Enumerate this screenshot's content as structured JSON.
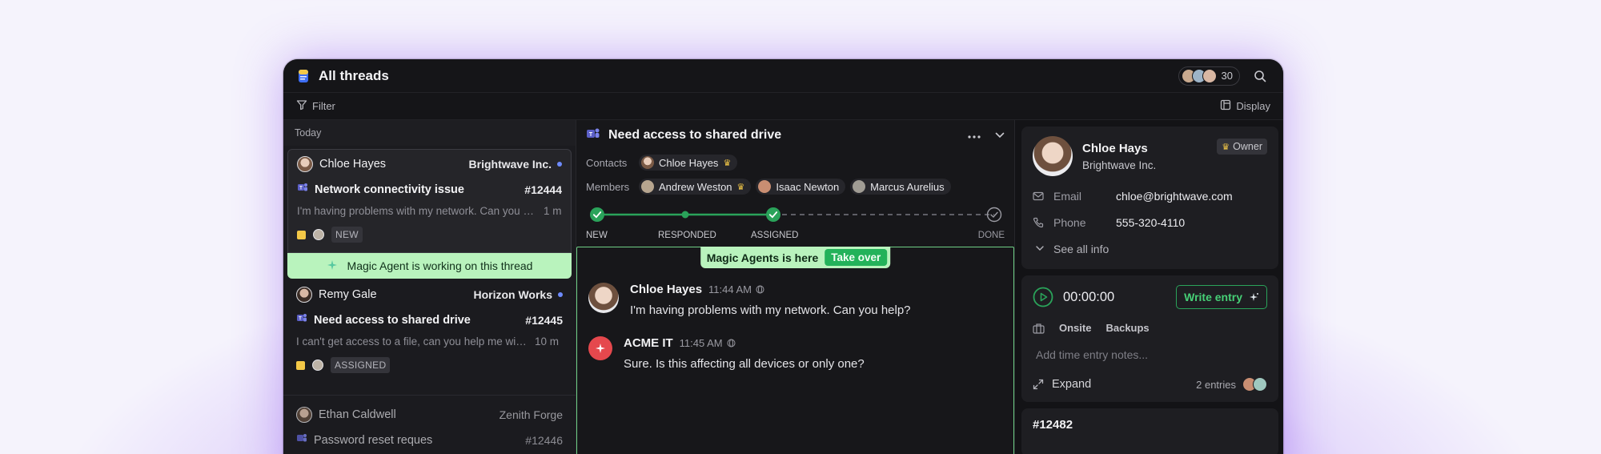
{
  "header": {
    "title": "All threads",
    "avatar_count": "30"
  },
  "filterbar": {
    "filter_label": "Filter",
    "display_label": "Display"
  },
  "list": {
    "group_label": "Today",
    "threads": [
      {
        "name": "Chloe Hayes",
        "company": "Brightwave Inc.",
        "subject": "Network connectivity issue",
        "ticket": "#12444",
        "preview": "I'm having problems with my network. Can you help?",
        "time": "1 m",
        "status": "NEW"
      },
      {
        "name": "Remy Gale",
        "company": "Horizon Works",
        "subject": "Need access to shared drive",
        "ticket": "#12445",
        "preview": "I can't get access to a file, can you help me with this?",
        "time": "10 m",
        "status": "ASSIGNED"
      },
      {
        "name": "Ethan Caldwell",
        "company": "Zenith Forge",
        "subject": "Password reset reques",
        "ticket": "#12446"
      }
    ],
    "agent_banner": "Magic Agent is working on this thread"
  },
  "thread": {
    "title": "Need access to shared drive",
    "contacts_label": "Contacts",
    "contacts": [
      "Chloe Hayes"
    ],
    "members_label": "Members",
    "members": [
      "Andrew Weston",
      "Isaac Newton",
      "Marcus Aurelius"
    ],
    "steps": [
      "NEW",
      "RESPONDED",
      "ASSIGNED",
      "DONE"
    ],
    "progress_completed_steps": 3,
    "magic_banner": "Magic Agents is here",
    "take_over_label": "Take over",
    "messages": [
      {
        "author": "Chloe Hayes",
        "time": "11:44 AM",
        "text": "I'm having problems with my network. Can you help?"
      },
      {
        "author": "ACME IT",
        "time": "11:45 AM",
        "text": "Sure. Is this affecting all devices or only one?"
      }
    ]
  },
  "contact_panel": {
    "name": "Chloe Hays",
    "company": "Brightwave Inc.",
    "role": "Owner",
    "email_label": "Email",
    "email": "chloe@brightwave.com",
    "phone_label": "Phone",
    "phone": "555-320-4110",
    "see_all": "See all info"
  },
  "time_panel": {
    "timer": "00:00:00",
    "write_entry_label": "Write entry",
    "tags": [
      "Onsite",
      "Backups"
    ],
    "notes_placeholder": "Add time entry notes...",
    "expand_label": "Expand",
    "entries": "2 entries"
  },
  "next_ticket": "#12482",
  "colors": {
    "accent_green": "#23b25a",
    "agent_green": "#b9f3bd",
    "unread_dot": "#6e8bff",
    "tag_yellow": "#f3c847"
  }
}
